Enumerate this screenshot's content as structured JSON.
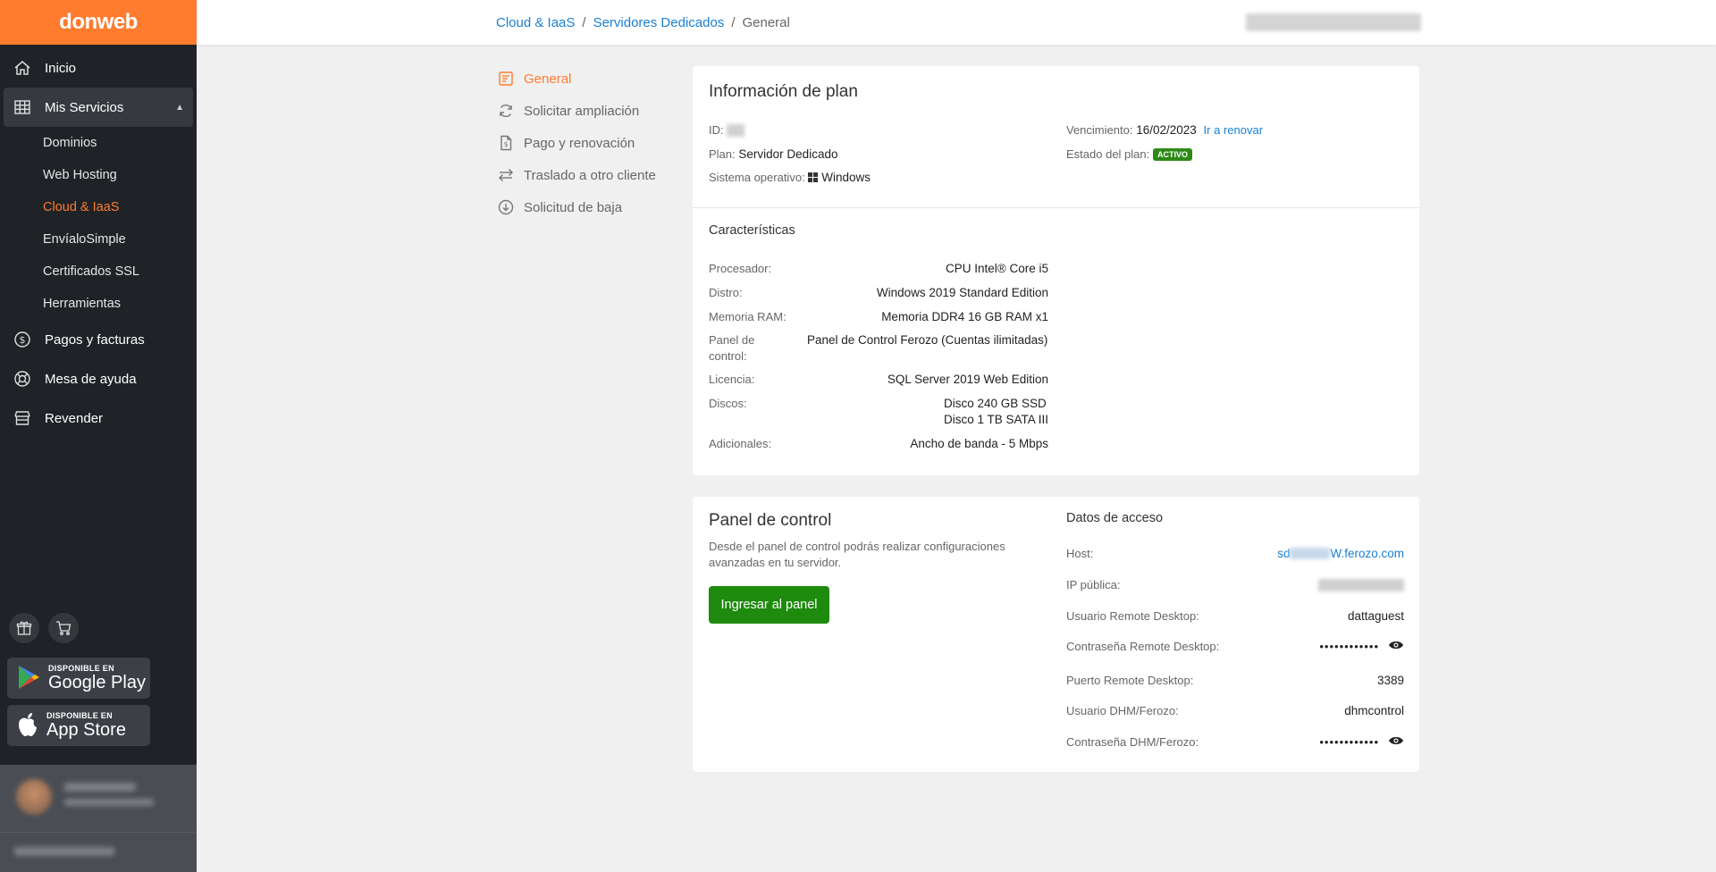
{
  "brand": {
    "name": "donweb",
    "accent": "#ff7b2e"
  },
  "sidebar": {
    "items": [
      {
        "label": "Inicio",
        "icon": "home-icon"
      },
      {
        "label": "Mis Servicios",
        "icon": "grid-icon"
      },
      {
        "label": "Pagos y facturas",
        "icon": "dollar-icon"
      },
      {
        "label": "Mesa de ayuda",
        "icon": "lifebuoy-icon"
      },
      {
        "label": "Revender",
        "icon": "store-icon"
      }
    ],
    "subitems": [
      "Dominios",
      "Web Hosting",
      "Cloud & IaaS",
      "EnvíaloSimple",
      "Certificados SSL",
      "Herramientas"
    ],
    "google_play": {
      "small": "DISPONIBLE EN",
      "big": "Google Play"
    },
    "app_store": {
      "small": "DISPONIBLE EN",
      "big": "App Store"
    }
  },
  "breadcrumb": {
    "level1": "Cloud & IaaS",
    "level2": "Servidores Dedicados",
    "current": "General",
    "sep": "/"
  },
  "submenu": [
    "General",
    "Solicitar ampliación",
    "Pago y renovación",
    "Traslado a otro cliente",
    "Solicitud de baja"
  ],
  "plan": {
    "title": "Información de plan",
    "id_label": "ID:",
    "plan_label": "Plan:",
    "plan_value": "Servidor Dedicado",
    "os_label": "Sistema operativo:",
    "os_value": "Windows",
    "expiry_label": "Vencimiento:",
    "expiry_value": "16/02/2023",
    "renew_link": "Ir a renovar",
    "status_label": "Estado del plan:",
    "status_value": "ACTIVO"
  },
  "features": {
    "title": "Características",
    "rows": [
      {
        "label": "Procesador:",
        "value": "CPU Intel® Core i5"
      },
      {
        "label": "Distro:",
        "value": "Windows 2019 Standard Edition"
      },
      {
        "label": "Memoria RAM:",
        "value": "Memoria DDR4 16 GB RAM x1"
      },
      {
        "label": "Panel de control:",
        "value": "Panel de Control Ferozo (Cuentas ilimitadas)"
      },
      {
        "label": "Licencia:",
        "value": "SQL Server 2019 Web Edition"
      },
      {
        "label": "Discos:",
        "value": "Disco 240 GB SSD",
        "value2": "Disco 1 TB SATA III"
      },
      {
        "label": "Adicionales:",
        "value": "Ancho de banda - 5 Mbps"
      }
    ]
  },
  "panel": {
    "title": "Panel de control",
    "description": "Desde el panel de control podrás realizar configuraciones avanzadas en tu servidor.",
    "button": "Ingresar al panel"
  },
  "access": {
    "title": "Datos de acceso",
    "host_label": "Host:",
    "host_prefix": "sd",
    "host_suffix": "W.ferozo.com",
    "ip_label": "IP pública:",
    "rdp_user_label": "Usuario Remote Desktop:",
    "rdp_user_value": "dattaguest",
    "rdp_pass_label": "Contraseña Remote Desktop:",
    "rdp_pass_value": "••••••••••••",
    "rdp_port_label": "Puerto Remote Desktop:",
    "rdp_port_value": "3389",
    "dhm_user_label": "Usuario DHM/Ferozo:",
    "dhm_user_value": "dhmcontrol",
    "dhm_pass_label": "Contraseña DHM/Ferozo:",
    "dhm_pass_value": "••••••••••••"
  }
}
